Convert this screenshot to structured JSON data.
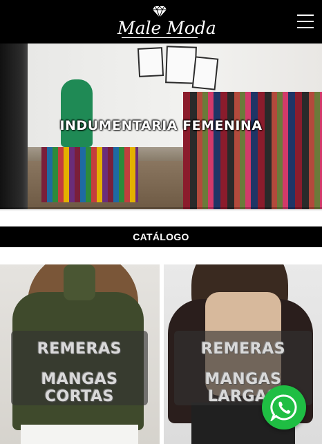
{
  "header": {
    "logo_text": "Male Moda",
    "logo_icon": "diamond-icon",
    "menu_icon": "hamburger-menu-icon",
    "background": "#000000"
  },
  "hero": {
    "title": "INDUMENTARIA FEMENINA"
  },
  "catalog": {
    "title": "CATÁLOGO",
    "cards": [
      {
        "line1": "REMERAS",
        "line2": "MANGAS CORTAS"
      },
      {
        "line1": "REMERAS",
        "line2": "MANGAS LARGAS"
      }
    ]
  },
  "whatsapp": {
    "icon": "whatsapp-icon",
    "color": "#1fbe43"
  }
}
